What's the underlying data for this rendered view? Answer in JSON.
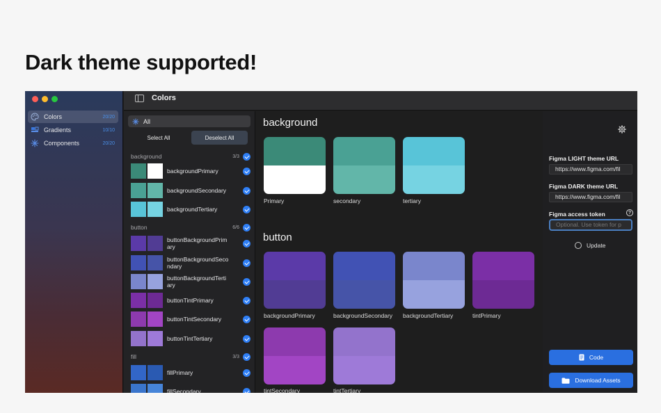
{
  "headline": "Dark theme supported!",
  "window_title": "Colors",
  "sidebar": {
    "items": [
      {
        "label": "Colors",
        "count": "20/20",
        "icon": "palette-icon",
        "selected": true
      },
      {
        "label": "Gradients",
        "count": "10/10",
        "icon": "gradients-icon",
        "selected": false
      },
      {
        "label": "Components",
        "count": "20/20",
        "icon": "components-icon",
        "selected": false
      }
    ]
  },
  "list": {
    "all_label": "All",
    "select_all": "Select All",
    "deselect_all": "Deselect All",
    "sections": [
      {
        "name": "background",
        "count": "3/3",
        "items": [
          {
            "name": "backgroundPrimary",
            "light": "#3b8a78",
            "dark": "#ffffff"
          },
          {
            "name": "backgroundSecondary",
            "light": "#4aa194",
            "dark": "#62b6a9"
          },
          {
            "name": "backgroundTertiary",
            "light": "#58c4d8",
            "dark": "#76d3e2"
          }
        ]
      },
      {
        "name": "button",
        "count": "6/6",
        "items": [
          {
            "name": "buttonBackgroundPrimary",
            "light": "#5b3aa8",
            "dark": "#513c94"
          },
          {
            "name": "buttonBackgroundSecondary",
            "light": "#4152b4",
            "dark": "#4654a8"
          },
          {
            "name": "buttonBackgroundTertiary",
            "light": "#7a86cc",
            "dark": "#97a2de"
          },
          {
            "name": "buttonTintPrimary",
            "light": "#7b2fa6",
            "dark": "#6d2a94"
          },
          {
            "name": "buttonTintSecondary",
            "light": "#8d3aae",
            "dark": "#a245c4"
          },
          {
            "name": "buttonTintTertiary",
            "light": "#9373cc",
            "dark": "#9e7ad8"
          }
        ]
      },
      {
        "name": "fill",
        "count": "3/3",
        "items": [
          {
            "name": "fillPrimary",
            "light": "#3266c8",
            "dark": "#2a5ab2"
          },
          {
            "name": "fillSecondary",
            "light": "#3a75cc",
            "dark": "#4684d8"
          }
        ]
      }
    ]
  },
  "main": {
    "groups": [
      {
        "title": "background",
        "tiles": [
          {
            "label": "Primary",
            "top": "#3b8a78",
            "bottom": "#ffffff"
          },
          {
            "label": "secondary",
            "top": "#4aa194",
            "bottom": "#62b6a9"
          },
          {
            "label": "tertiary",
            "top": "#58c4d8",
            "bottom": "#76d3e2"
          }
        ]
      },
      {
        "title": "button",
        "tiles": [
          {
            "label": "backgroundPrimary",
            "top": "#5b3aa8",
            "bottom": "#513c94"
          },
          {
            "label": "backgroundSecondary",
            "top": "#4152b4",
            "bottom": "#4654a8"
          },
          {
            "label": "backgroundTertiary",
            "top": "#7a86cc",
            "bottom": "#97a2de"
          },
          {
            "label": "tintPrimary",
            "top": "#7b2fa6",
            "bottom": "#6d2a94"
          },
          {
            "label": "tintSecondary",
            "top": "#8d3aae",
            "bottom": "#a245c4"
          },
          {
            "label": "tintTertiary",
            "top": "#9373cc",
            "bottom": "#9e7ad8"
          }
        ]
      }
    ]
  },
  "panel": {
    "light_label": "Figma LIGHT theme URL",
    "light_value": "https://www.figma.com/fil",
    "dark_label": "Figma DARK theme URL",
    "dark_value": "https://www.figma.com/fil",
    "token_label": "Figma access token",
    "token_placeholder": "Optional. Use token for p",
    "update_label": "Update",
    "code_label": "Code",
    "download_label": "Download Assets"
  },
  "colors": {
    "accent": "#2f7ff6",
    "button_blue": "#2a6fe0",
    "count_blue": "#4a8fe8"
  }
}
